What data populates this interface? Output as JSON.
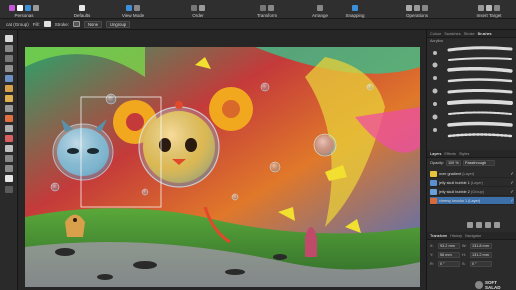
{
  "toolbar": {
    "groups": [
      {
        "label": "Personas"
      },
      {
        "label": "Defaults"
      },
      {
        "label": "View Mode"
      },
      {
        "label": "Order"
      },
      {
        "label": "Transform"
      },
      {
        "label": "Arrange"
      },
      {
        "label": "Snapping"
      },
      {
        "label": "Operations"
      },
      {
        "label": "Insert Target"
      }
    ]
  },
  "context": {
    "selection": "cat (Group)",
    "fill_label": "Fill:",
    "stroke_label": "Stroke:",
    "blend_value": "None",
    "ungroup_label": "Ungroup"
  },
  "panel": {
    "tabs": [
      {
        "label": "Colour",
        "active": false
      },
      {
        "label": "Swatches",
        "active": false
      },
      {
        "label": "Stroke",
        "active": false
      },
      {
        "label": "Brushes",
        "active": true
      }
    ],
    "brush_category": "Acrylics",
    "layer_tabs": [
      {
        "label": "Layers",
        "active": true
      },
      {
        "label": "Effects",
        "active": false
      },
      {
        "label": "Styles",
        "active": false
      }
    ],
    "opacity_label": "Opacity:",
    "opacity_value": "100 %",
    "blend_mode": "Passthrough",
    "layers": [
      {
        "name": "over gradient",
        "kind": "(Layer)",
        "color": "#e8c43a"
      },
      {
        "name": "jelly skull bubble 1",
        "kind": "(Layer)",
        "color": "#5a8fd0"
      },
      {
        "name": "jelly skull bubble 2",
        "kind": "(Group)",
        "color": "#6aa0d8"
      },
      {
        "name": "cheesy knocks 1",
        "kind": "(Layer)",
        "color": "#d86a3a"
      }
    ],
    "bottom_tabs": [
      {
        "label": "Transform",
        "active": true
      },
      {
        "label": "History",
        "active": false
      },
      {
        "label": "Navigator",
        "active": false
      }
    ],
    "transform": [
      {
        "l1": "X:",
        "v1": "93.2 mm",
        "l2": "W:",
        "v2": "131.8 mm"
      },
      {
        "l1": "Y:",
        "v1": "56 mm",
        "l2": "H:",
        "v2": "131.2 mm"
      },
      {
        "l1": "R:",
        "v1": "0 °",
        "l2": "S:",
        "v2": "0 °"
      }
    ]
  },
  "watermark": {
    "line1": "SOFT",
    "line2": "SALAD"
  },
  "colors": {
    "accent": "#3d8fd9",
    "chrome": "#2f2f2f"
  }
}
